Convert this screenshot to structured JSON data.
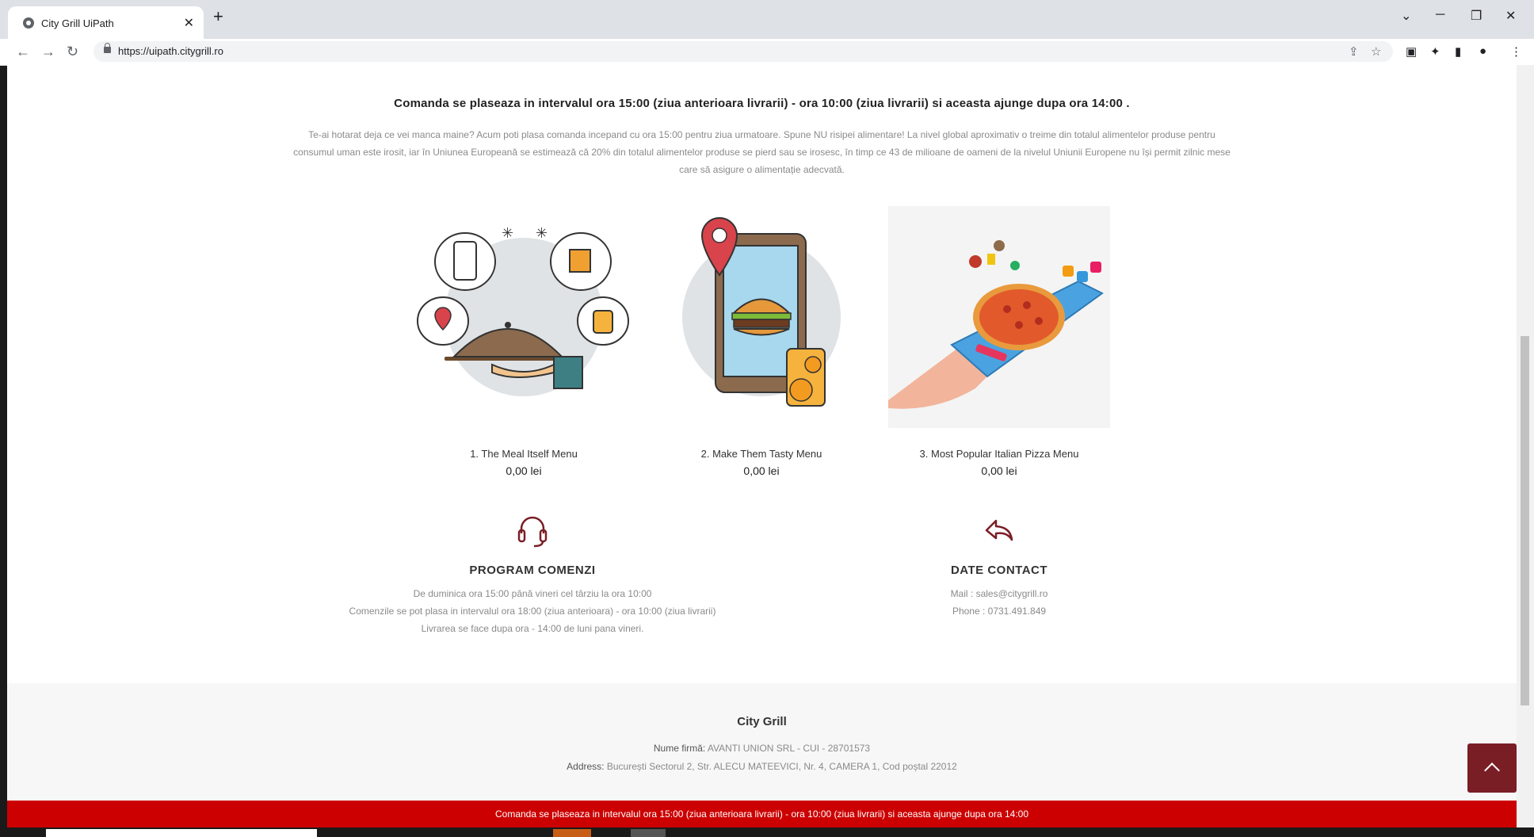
{
  "browser": {
    "tab_title": "City Grill UiPath",
    "url": "https://uipath.citygrill.ro",
    "new_tab": "+",
    "tab_close": "✕"
  },
  "page": {
    "headline": "Comanda se plaseaza in intervalul ora 15:00 (ziua anterioara livrarii) - ora 10:00 (ziua livrarii) si aceasta ajunge dupa ora 14:00 .",
    "intro": "Te-ai hotarat deja ce vei manca maine? Acum poti plasa comanda incepand cu ora 15:00 pentru ziua urmatoare. Spune NU risipei alimentare! La nivel global aproximativ o treime din totalul alimentelor produse pentru consumul uman este irosit, iar în Uniunea Europeană se estimează că 20% din totalul alimentelor produse se pierd sau se irosesc, în timp ce 43 de milioane de oameni de la nivelul Uniunii Europene nu își permit zilnic mese care să asigure o alimentație adecvată.",
    "menus": [
      {
        "title": "1. The Meal Itself Menu",
        "price": "0,00 lei"
      },
      {
        "title": "2. Make Them Tasty Menu",
        "price": "0,00 lei"
      },
      {
        "title": "3. Most Popular Italian Pizza Menu",
        "price": "0,00 lei"
      }
    ],
    "program": {
      "title": "PROGRAM COMENZI",
      "lines": [
        "De duminica ora 15:00 până vineri cel târziu la ora 10:00",
        "Comenzile se pot plasa in intervalul ora 18:00 (ziua anterioara) - ora 10:00 (ziua livrarii)",
        "Livrarea se face dupa ora - 14:00 de luni pana vineri."
      ]
    },
    "contact": {
      "title": "DATE CONTACT",
      "mail": "Mail : sales@citygrill.ro",
      "phone": "Phone : 0731.491.849"
    }
  },
  "footer": {
    "title": "City Grill",
    "company_label": "Nume firmă:",
    "company_value": "AVANTI UNION SRL - CUI - 28701573",
    "address_label": "Address:",
    "address_value": "București Sectorul 2, Str. ALECU MATEEVICI, Nr. 4, CAMERA 1, Cod poștal 22012"
  },
  "banner": "Comanda se plaseaza in intervalul ora 15:00 (ziua anterioara livrarii) - ora 10:00 (ziua livrarii) si aceasta ajunge dupa ora 14:00",
  "colors": {
    "brand_dark_red": "#7a1e26",
    "banner_red": "#cc0000"
  },
  "icons": [
    "headset-icon",
    "reply-arrow-icon",
    "back-to-top-icon",
    "lock-icon"
  ]
}
